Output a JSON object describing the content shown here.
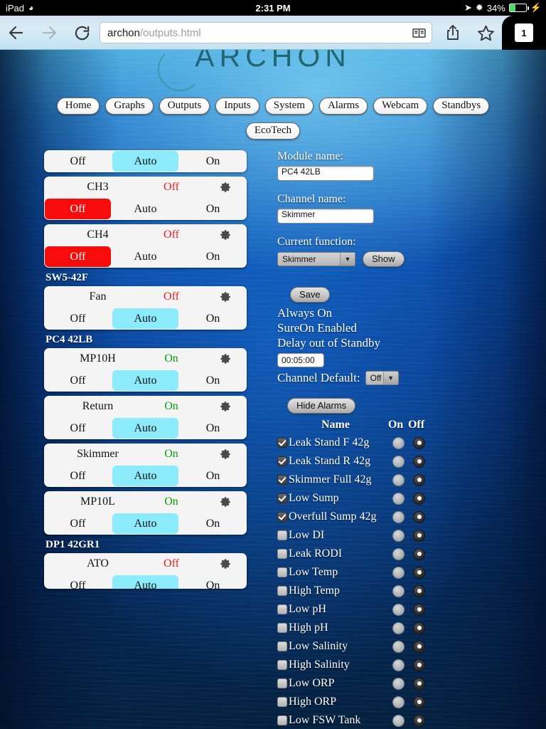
{
  "status_bar": {
    "carrier": "iPad",
    "wifi_icon": "wifi-icon",
    "time": "2:31 PM",
    "location_icon": "location-arrow-icon",
    "bluetooth_icon": "bluetooth-icon",
    "battery_percent": "34%",
    "charging_icon": "lightning-bolt-icon"
  },
  "browser": {
    "back_icon": "back-arrow-icon",
    "forward_icon": "forward-arrow-icon",
    "reload_icon": "reload-icon",
    "url_host": "archon",
    "url_path": "/outputs.html",
    "reader_icon": "reader-view-icon",
    "share_icon": "share-icon",
    "bookmark_icon": "bookmark-star-icon",
    "tab_count": "1"
  },
  "site": {
    "logo_text": "ARCHON",
    "nav": [
      {
        "label": "Home"
      },
      {
        "label": "Graphs"
      },
      {
        "label": "Outputs"
      },
      {
        "label": "Inputs"
      },
      {
        "label": "System"
      },
      {
        "label": "Alarms"
      },
      {
        "label": "Webcam"
      },
      {
        "label": "Standbys"
      }
    ],
    "nav_second": [
      {
        "label": "EcoTech"
      }
    ]
  },
  "outputs": {
    "segment_labels": {
      "off": "Off",
      "auto": "Auto",
      "on": "On"
    },
    "gear_icon": "gear-icon",
    "groups": [
      {
        "module": "",
        "show_module_label": false,
        "channels": [
          {
            "name": "",
            "state": "",
            "state_class": "",
            "mode": "auto",
            "partial_top": true
          }
        ]
      },
      {
        "module": "",
        "show_module_label": false,
        "channels": [
          {
            "name": "CH3",
            "state": "Off",
            "state_class": "off",
            "mode": "off"
          },
          {
            "name": "CH4",
            "state": "Off",
            "state_class": "off",
            "mode": "off"
          }
        ]
      },
      {
        "module": "SW5-42F",
        "show_module_label": true,
        "channels": [
          {
            "name": "Fan",
            "state": "Off",
            "state_class": "off",
            "mode": "auto"
          }
        ]
      },
      {
        "module": "PC4 42LB",
        "show_module_label": true,
        "channels": [
          {
            "name": "MP10H",
            "state": "On",
            "state_class": "on",
            "mode": "auto"
          },
          {
            "name": "Return",
            "state": "On",
            "state_class": "on",
            "mode": "auto"
          },
          {
            "name": "Skimmer",
            "state": "On",
            "state_class": "on",
            "mode": "auto"
          },
          {
            "name": "MP10L",
            "state": "On",
            "state_class": "on",
            "mode": "auto"
          }
        ]
      },
      {
        "module": "DP1 42GR1",
        "show_module_label": true,
        "channels": [
          {
            "name": "ATO",
            "state": "Off",
            "state_class": "off",
            "mode": "auto",
            "clipped": true
          }
        ]
      }
    ]
  },
  "detail": {
    "module_name_label": "Module name:",
    "module_name_value": "PC4 42LB",
    "channel_name_label": "Channel name:",
    "channel_name_value": "Skimmer",
    "current_function_label": "Current function:",
    "current_function_value": "Skimmer",
    "show_button": "Show",
    "save_button": "Save",
    "always_on": "Always On",
    "sure_on": "SureOn Enabled",
    "delay_label": "Delay out of Standby",
    "delay_value": "00:05:00",
    "channel_default_label": "Channel Default:",
    "channel_default_value": "Off",
    "hide_alarms_button": "Hide Alarms",
    "dropdown_arrow_icon": "chevron-down-icon"
  },
  "alarms": {
    "headers": {
      "name": "Name",
      "on": "On",
      "off": "Off"
    },
    "rows": [
      {
        "name": "Leak Stand F 42g",
        "enabled": true,
        "selected": "off"
      },
      {
        "name": "Leak Stand R 42g",
        "enabled": true,
        "selected": "off"
      },
      {
        "name": "Skimmer Full 42g",
        "enabled": true,
        "selected": "off"
      },
      {
        "name": "Low Sump",
        "enabled": true,
        "selected": "off"
      },
      {
        "name": "Overfull Sump 42g",
        "enabled": true,
        "selected": "off"
      },
      {
        "name": "Low DI",
        "enabled": false,
        "selected": "off"
      },
      {
        "name": "Leak RODI",
        "enabled": false,
        "selected": "off"
      },
      {
        "name": "Low Temp",
        "enabled": false,
        "selected": "off"
      },
      {
        "name": "High Temp",
        "enabled": false,
        "selected": "off"
      },
      {
        "name": "Low pH",
        "enabled": false,
        "selected": "off"
      },
      {
        "name": "High pH",
        "enabled": false,
        "selected": "off"
      },
      {
        "name": "Low Salinity",
        "enabled": false,
        "selected": "off"
      },
      {
        "name": "High Salinity",
        "enabled": false,
        "selected": "off"
      },
      {
        "name": "Low ORP",
        "enabled": false,
        "selected": "off"
      },
      {
        "name": "High ORP",
        "enabled": false,
        "selected": "off"
      },
      {
        "name": "Low FSW Tank",
        "enabled": false,
        "selected": "off"
      }
    ]
  },
  "colors": {
    "selected_auto": "#8bebfb",
    "selected_off": "#f80b0b",
    "state_on": "#0a9b0a",
    "state_off": "#f02020",
    "logo": "#1b5f6c"
  }
}
